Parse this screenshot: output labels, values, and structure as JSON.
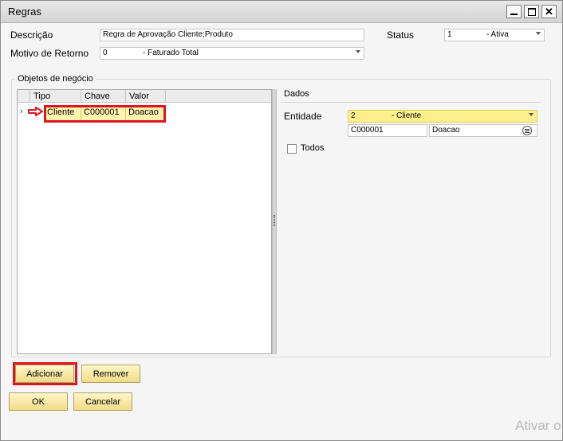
{
  "window": {
    "title": "Regras"
  },
  "header": {
    "descricao_label": "Descrição",
    "descricao_value": "Regra de Aprovação Cliente;Produto",
    "status_label": "Status",
    "status_code": "1",
    "status_text": "- Ativa",
    "motivo_label": "Motivo de Retorno",
    "motivo_code": "0",
    "motivo_text": "- Faturado Total"
  },
  "objetos": {
    "group_label": "Objetos de negócio",
    "columns": [
      "Tipo",
      "Chave",
      "Valor"
    ],
    "rows": [
      {
        "tipo": "Cliente",
        "chave": "C000001",
        "valor": "Doacao"
      }
    ]
  },
  "dados": {
    "label": "Dados",
    "entidade_label": "Entidade",
    "entidade_code": "2",
    "entidade_text": "- Cliente",
    "chave_value": "C000001",
    "valor_value": "Doacao",
    "todos_label": "Todos"
  },
  "buttons": {
    "adicionar": "Adicionar",
    "remover": "Remover",
    "ok": "OK",
    "cancelar": "Cancelar"
  },
  "watermark": "Ativar o",
  "colors": {
    "highlight": "#e0141e",
    "button_fill": "#f4e08f",
    "row_fill": "#fff3b0"
  }
}
